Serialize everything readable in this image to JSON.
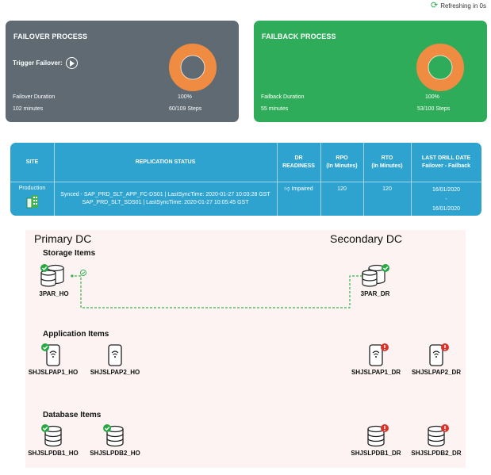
{
  "refresh": {
    "text": "Refreshing in 0s",
    "icon": "refresh-icon"
  },
  "failover": {
    "title": "FAILOVER PROCESS",
    "trigger_label": "Trigger Failover:",
    "duration_label": "Failover Duration",
    "duration_value": "102 minutes",
    "percent": "100%",
    "steps": "60/109 Steps",
    "progress": 1.0
  },
  "failback": {
    "title": "FAILBACK PROCESS",
    "duration_label": "Failback Duration",
    "duration_value": "55 minutes",
    "percent": "100%",
    "steps": "53/100 Steps",
    "progress": 1.0
  },
  "colors": {
    "failover_bg": "#5f6a73",
    "failback_bg": "#2fac59",
    "donut": "#f08c42",
    "table_bg": "#2ea3cf",
    "ok": "#27a844",
    "error": "#d9342b"
  },
  "table": {
    "headers": {
      "site": "SITE",
      "replication": "REPLICATION STATUS",
      "dr1": "DR",
      "dr2": "READINESS",
      "rpo1": "RPO",
      "rpo2": "(In Minutes)",
      "rto1": "RTO",
      "rto2": "(In Minutes)",
      "ld1": "LAST DRILL DATE",
      "ld2": "Failover - Failback"
    },
    "row": {
      "site": "Production",
      "replication_line1": "Synced - SAP_PRD_SLT_APP_FC-DS01 | LastSyncTime: 2020-01-27 10:03:28 GST",
      "replication_line2": "SAP_PRD_SLT_SDS01 | LastSyncTime: 2020-01-27 10:05:45 GST",
      "readiness": "Impaired",
      "rpo": "120",
      "rto": "120",
      "drill_failover": "16/01/2020",
      "drill_sep": "-",
      "drill_failback": "16/01/2020"
    }
  },
  "topology": {
    "primary": "Primary DC",
    "secondary": "Secondary DC",
    "storage_title": "Storage Items",
    "application_title": "Application Items",
    "database_title": "Database Items",
    "storage": {
      "ho": "3PAR_HO",
      "dr": "3PAR_DR"
    },
    "apps": [
      "SHJSLPAP1_HO",
      "SHJSLPAP2_HO",
      "SHJSLPAP1_DR",
      "SHJSLPAP2_DR"
    ],
    "dbs": [
      "SHJSLPDB1_HO",
      "SHJSLPDB2_HO",
      "SHJSLPDB1_DR",
      "SHJSLPDB2_DR"
    ]
  }
}
